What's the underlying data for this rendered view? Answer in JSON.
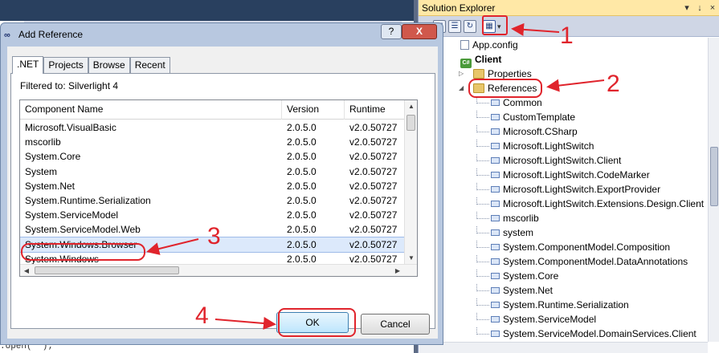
{
  "dialog": {
    "title": "Add Reference",
    "help_label": "?",
    "close_label": "X",
    "tabs": [
      ".NET",
      "Projects",
      "Browse",
      "Recent"
    ],
    "filter_text": "Filtered to: Silverlight 4",
    "columns": [
      "Component Name",
      "Version",
      "Runtime"
    ],
    "rows": [
      {
        "name": "Microsoft.VisualBasic",
        "version": "2.0.5.0",
        "runtime": "v2.0.50727"
      },
      {
        "name": "mscorlib",
        "version": "2.0.5.0",
        "runtime": "v2.0.50727"
      },
      {
        "name": "System.Core",
        "version": "2.0.5.0",
        "runtime": "v2.0.50727"
      },
      {
        "name": "System",
        "version": "2.0.5.0",
        "runtime": "v2.0.50727"
      },
      {
        "name": "System.Net",
        "version": "2.0.5.0",
        "runtime": "v2.0.50727"
      },
      {
        "name": "System.Runtime.Serialization",
        "version": "2.0.5.0",
        "runtime": "v2.0.50727"
      },
      {
        "name": "System.ServiceModel",
        "version": "2.0.5.0",
        "runtime": "v2.0.50727"
      },
      {
        "name": "System.ServiceModel.Web",
        "version": "2.0.5.0",
        "runtime": "v2.0.50727"
      },
      {
        "name": "System.Windows.Browser",
        "version": "2.0.5.0",
        "runtime": "v2.0.50727"
      },
      {
        "name": "System.Windows",
        "version": "2.0.5.0",
        "runtime": "v2.0.50727"
      }
    ],
    "selected_row": "System.Windows.Browser",
    "ok_label": "OK",
    "cancel_label": "Cancel"
  },
  "solution_explorer": {
    "title": "Solution Explorer",
    "pin_label": "↓",
    "close_label": "×",
    "tree": {
      "app_config": "App.config",
      "project": "Client",
      "properties": "Properties",
      "references": "References",
      "reference_items": [
        "Common",
        "CustomTemplate",
        "Microsoft.CSharp",
        "Microsoft.LightSwitch",
        "Microsoft.LightSwitch.Client",
        "Microsoft.LightSwitch.CodeMarker",
        "Microsoft.LightSwitch.ExportProvider",
        "Microsoft.LightSwitch.Extensions.Design.Client",
        "mscorlib",
        "system",
        "System.ComponentModel.Composition",
        "System.ComponentModel.DataAnnotations",
        "System.Core",
        "System.Net",
        "System.Runtime.Serialization",
        "System.ServiceModel",
        "System.ServiceModel.DomainServices.Client"
      ]
    }
  },
  "background": {
    "code_fragment": ".open(\"\");"
  },
  "annotations": {
    "labels": [
      "1",
      "2",
      "3",
      "4"
    ],
    "color": "#e0242c"
  },
  "colors": {
    "selection": "#dce9fb",
    "panel_title": "#ffe8a6",
    "ok_button": "#bee6fd"
  }
}
